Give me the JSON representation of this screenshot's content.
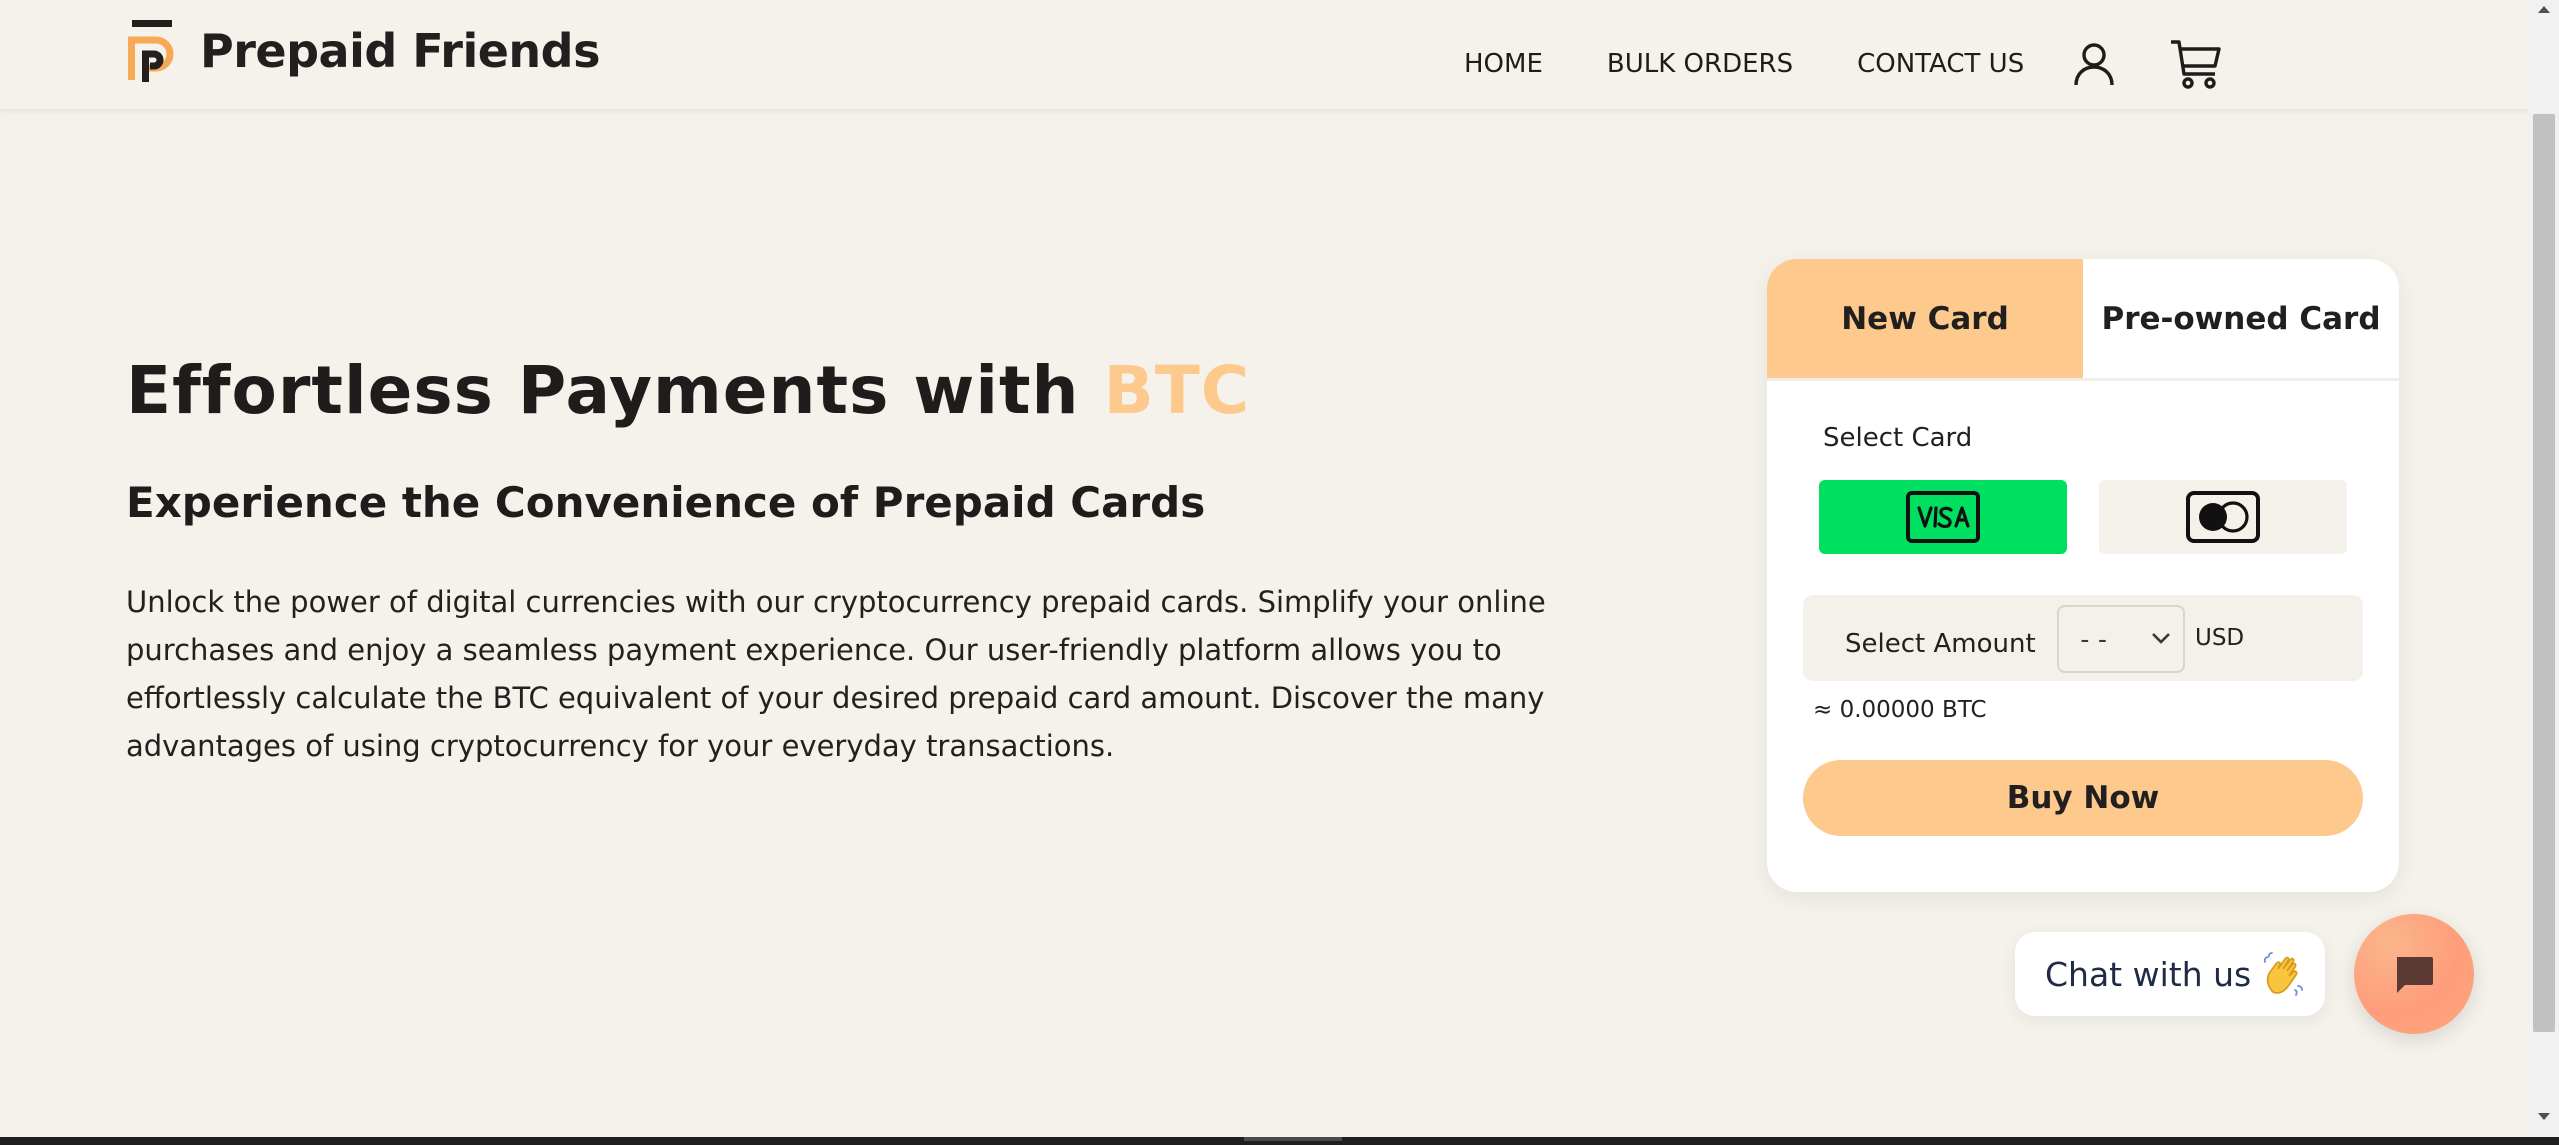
{
  "brand": {
    "name": "Prepaid Friends",
    "logo_icon": "pf-logo-icon",
    "accent_color": "#fec98d"
  },
  "nav": {
    "home": "HOME",
    "bulk_orders": "BULK ORDERS",
    "contact_us": "CONTACT US",
    "account_icon": "user-icon",
    "cart_icon": "cart-icon"
  },
  "hero": {
    "title_prefix": "Effortless Payments with ",
    "title_accent": "BTC",
    "subtitle": "Experience the Convenience of Prepaid Cards",
    "body": "Unlock the power of digital currencies with our cryptocurrency prepaid cards. Simplify your online purchases and enjoy a seamless payment experience. Our user-friendly platform allows you to effortlessly calculate the BTC equivalent of your desired prepaid card amount. Discover the many advantages of using cryptocurrency for your everyday transactions."
  },
  "purchase": {
    "tabs": [
      {
        "label": "New Card",
        "active": true
      },
      {
        "label": "Pre-owned Card",
        "active": false
      }
    ],
    "select_card_label": "Select Card",
    "card_brands": [
      {
        "name": "visa-card-icon",
        "selected": true,
        "selected_color": "#00e060"
      },
      {
        "name": "mastercard-card-icon",
        "selected": false
      }
    ],
    "select_amount_label": "Select Amount",
    "amount_value": "--",
    "currency": "USD",
    "btc_estimate": "≈ 0.00000 BTC",
    "buy_button": "Buy Now"
  },
  "chat": {
    "label": "Chat with us",
    "wave_icon": "waving-hand-icon",
    "button_icon": "chat-icon"
  }
}
